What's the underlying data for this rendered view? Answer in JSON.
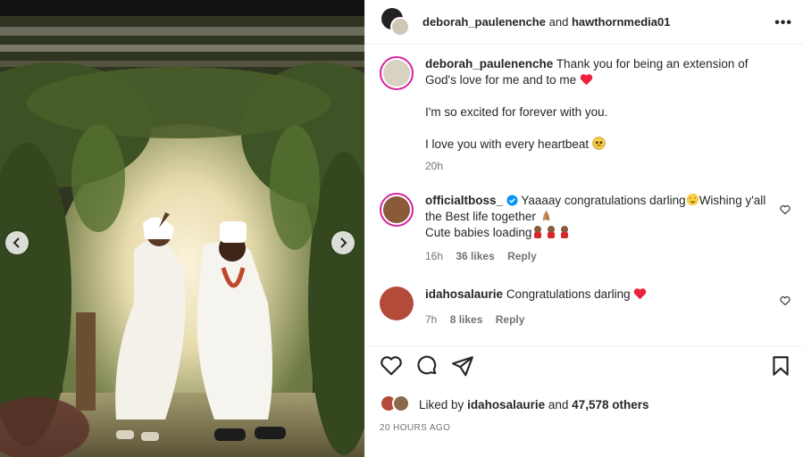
{
  "post": {
    "author": "deborah_paulenenche",
    "conjunction": "and",
    "collaborator": "hawthornmedia01",
    "more_label": "•••"
  },
  "photo": {
    "alt": "Couple in white traditional attire dancing under a vine-covered arch",
    "prev_icon": "chevron-left-icon",
    "next_icon": "chevron-right-icon"
  },
  "caption": {
    "username": "deborah_paulenenche",
    "line1": "Thank you for being an extension of God's love for me and to me",
    "line2": "I'm so excited for forever with you.",
    "line3": "I love you with every heartbeat",
    "time": "20h"
  },
  "comments": [
    {
      "username": "officialtboss_",
      "verified": true,
      "text1": "Yaaaay congratulations darling",
      "text2": "Wishing y'all the Best life together",
      "text3": "Cute babies loading",
      "time": "16h",
      "likes": "36 likes",
      "reply": "Reply"
    },
    {
      "username": "idahosalaurie",
      "text1": "Congratulations darling",
      "time": "7h",
      "likes": "8 likes",
      "reply": "Reply"
    }
  ],
  "likes": {
    "prefix": "Liked by",
    "user": "idahosalaurie",
    "conjunction": "and",
    "others": "47,578 others"
  },
  "timestamp": "20 HOURS AGO",
  "colors": {
    "heart_red": "#ed213a",
    "verified_blue": "#0095f6",
    "story_ring": "#d6249f"
  }
}
